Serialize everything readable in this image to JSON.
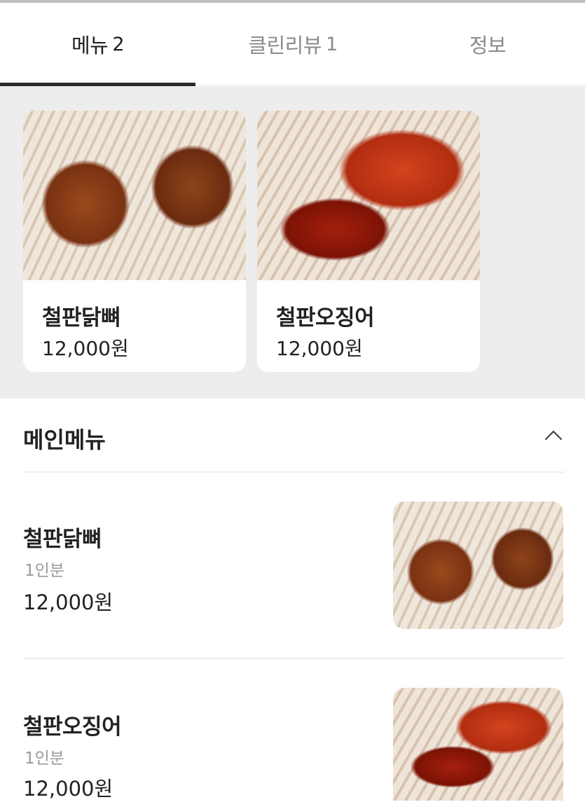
{
  "tabs": [
    {
      "label": "메뉴",
      "count": "2"
    },
    {
      "label": "클린리뷰",
      "count": "1"
    },
    {
      "label": "정보",
      "count": ""
    }
  ],
  "featured": [
    {
      "name": "철판닭뼈",
      "price": "12,000원",
      "image": "spicy-chicken-photo"
    },
    {
      "name": "철판오징어",
      "price": "12,000원",
      "image": "spicy-squid-photo"
    }
  ],
  "section": {
    "title": "메인메뉴",
    "collapse_icon": "chevron-up-icon"
  },
  "items": [
    {
      "name": "철판닭뼈",
      "serving": "1인분",
      "price": "12,000원",
      "image": "spicy-chicken-photo"
    },
    {
      "name": "철판오징어",
      "serving": "1인분",
      "price": "12,000원",
      "image": "spicy-squid-photo"
    }
  ],
  "colors": {
    "active_text": "#1e1e1e",
    "inactive_text": "#8a8a8a",
    "featured_bg": "#ededed",
    "muted_text": "#9a9a9a"
  }
}
